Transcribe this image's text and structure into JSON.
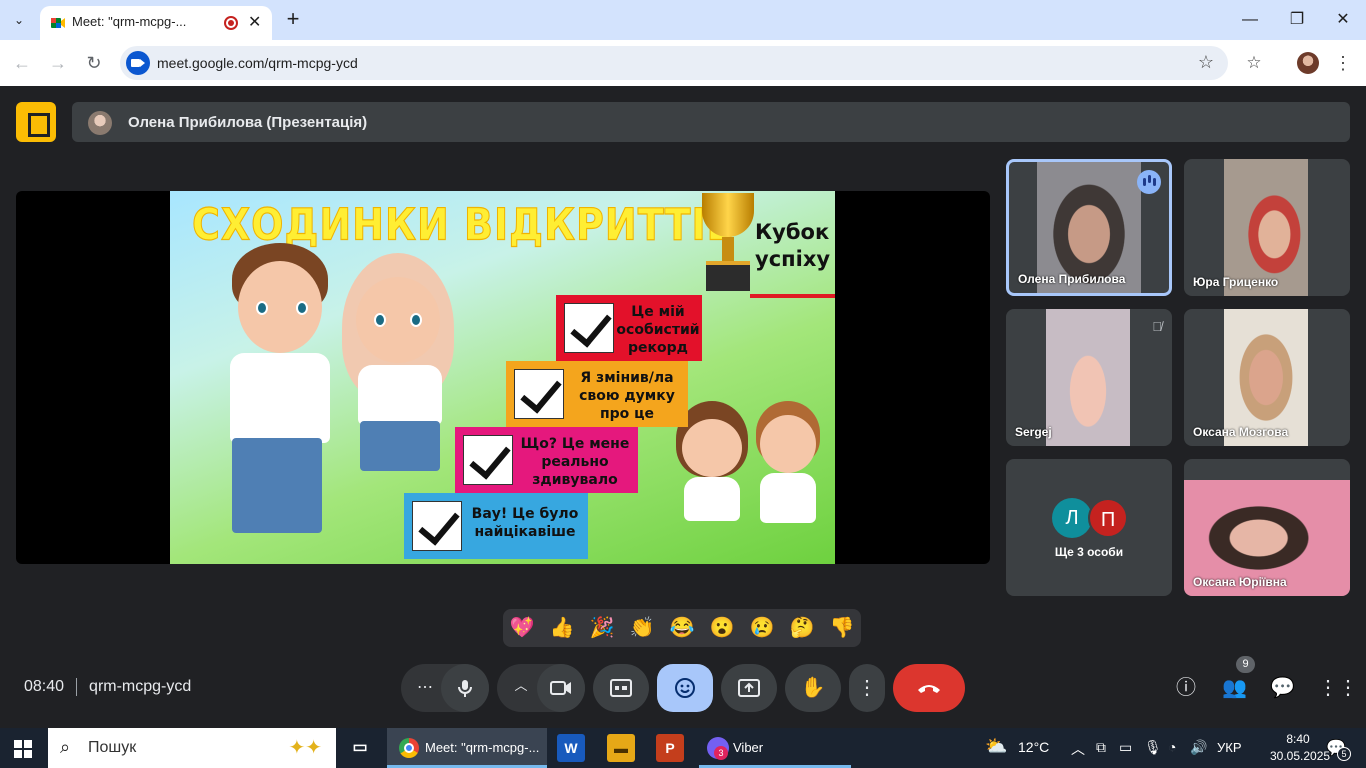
{
  "browser": {
    "tab_title": "Meet: \"qrm-mcpg-...",
    "url": "meet.google.com/qrm-mcpg-ycd",
    "icons": [
      "tab-search-icon",
      "meet-favicon",
      "recording-icon",
      "close-icon",
      "plus-icon",
      "minimize-icon",
      "restore-icon",
      "close-window-icon",
      "back-icon",
      "forward-icon",
      "reload-icon",
      "star-icon",
      "bookmarks-icon",
      "profile-avatar",
      "menu-icon"
    ]
  },
  "meet": {
    "presenter_label": "Олена Прибилова (Презентація)",
    "slide": {
      "title": "СХОДИНКИ ВІДКРИТТІВ",
      "cup_line1": "Кубок",
      "cup_line2": "успіху",
      "steps": [
        {
          "l1": "Це мій",
          "l2": "особистий",
          "l3": "рекорд"
        },
        {
          "l1": "Я змінив/ла",
          "l2": "свою думку",
          "l3": "про це"
        },
        {
          "l1": "Що? Це мене",
          "l2": "реально",
          "l3": "здивувало"
        },
        {
          "l1": "Вау! Це було",
          "l2": "найцікавіше"
        }
      ]
    },
    "participants": [
      {
        "name": "Олена Прибилова",
        "state": "speaking"
      },
      {
        "name": "Юра Гриценко"
      },
      {
        "name": "Sergej",
        "state": "muted"
      },
      {
        "name": "Оксана Мозгова"
      },
      {
        "name": "Ще 3 особи",
        "avatars": [
          "Л",
          "П"
        ]
      },
      {
        "name": "Оксана Юріївна"
      }
    ],
    "reactions": [
      "💖",
      "👍",
      "🎉",
      "👏",
      "😂",
      "😮",
      "😢",
      "🤔",
      "👎"
    ],
    "time": "08:40",
    "meeting_code": "qrm-mcpg-ycd",
    "people_count": "9",
    "colors": {
      "end_call": "#dc362e",
      "active_control": "#a8c7fa",
      "accent": "#8ab4f8"
    }
  },
  "taskbar": {
    "search_placeholder": "Пошук",
    "chrome_label": "Meet: \"qrm-mcpg-...",
    "viber_label": "Viber",
    "viber_badge": "3",
    "weather": "12°C",
    "lang": "УКР",
    "clock_time": "8:40",
    "clock_date": "30.05.2025",
    "notif_count": "5"
  }
}
